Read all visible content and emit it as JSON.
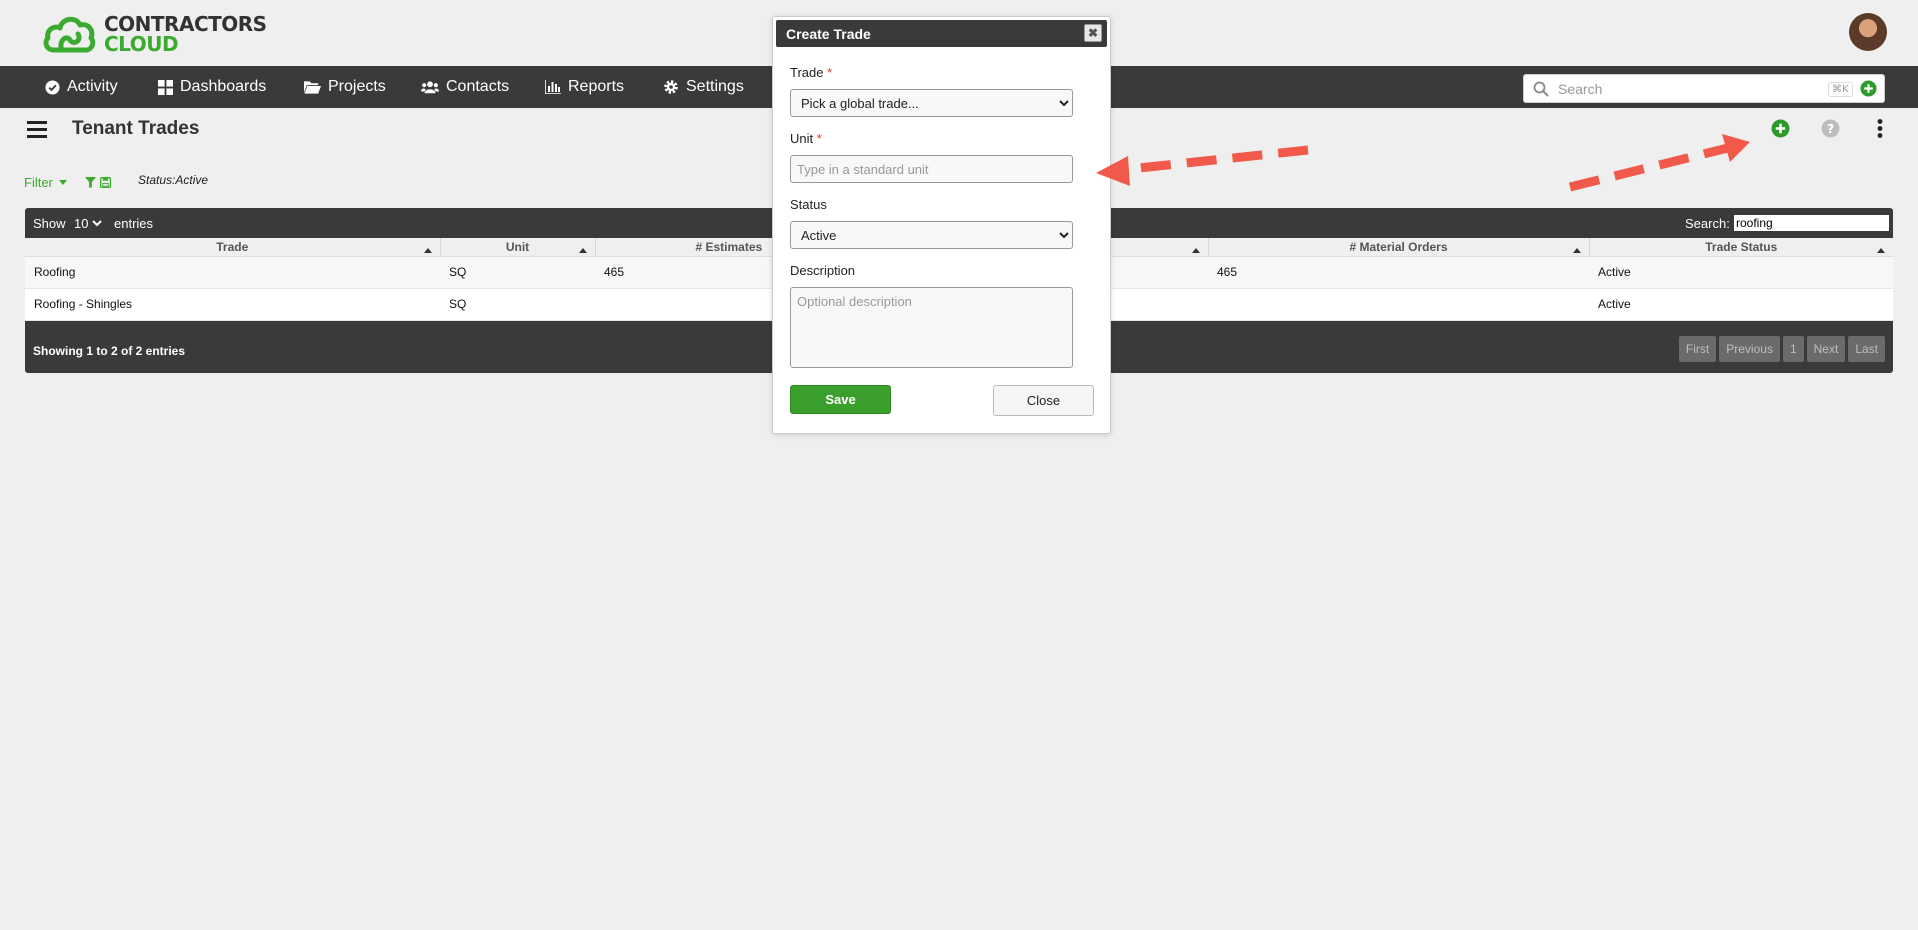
{
  "brand": {
    "line1": "CONTRACTORS",
    "line2": "CLOUD",
    "green": "#3bab2f",
    "dark": "#3a3a3a"
  },
  "nav": {
    "items": [
      {
        "label": "Activity",
        "icon": "check-circle-icon"
      },
      {
        "label": "Dashboards",
        "icon": "grid-icon"
      },
      {
        "label": "Projects",
        "icon": "folder-open-icon"
      },
      {
        "label": "Contacts",
        "icon": "users-icon"
      },
      {
        "label": "Reports",
        "icon": "bar-chart-icon"
      },
      {
        "label": "Settings",
        "icon": "gear-icon"
      }
    ],
    "search_placeholder": "Search",
    "shortcut": "⌘K"
  },
  "page": {
    "title": "Tenant Trades"
  },
  "filter": {
    "label": "Filter",
    "status": "Status:Active"
  },
  "table": {
    "show_label": "Show",
    "page_size": "10",
    "entries_label": "entries",
    "search_label": "Search:",
    "search_value": "roofing",
    "columns": [
      "Trade",
      "Unit",
      "# Estimates",
      "",
      "# Material Orders",
      "Trade Status"
    ],
    "rows": [
      [
        "Roofing",
        "SQ",
        "465",
        "",
        "465",
        "Active"
      ],
      [
        "Roofing - Shingles",
        "SQ",
        "",
        "",
        "",
        "Active"
      ]
    ],
    "footer": "Showing 1 to 2 of 2 entries",
    "pager": [
      "First",
      "Previous",
      "1",
      "Next",
      "Last"
    ]
  },
  "modal": {
    "title": "Create Trade",
    "close_x": "✖",
    "trade_label": "Trade",
    "trade_value": "Pick a global trade...",
    "unit_label": "Unit",
    "unit_placeholder": "Type in a standard unit",
    "status_label": "Status",
    "status_value": "Active",
    "description_label": "Description",
    "description_placeholder": "Optional description",
    "save_label": "Save",
    "close_label": "Close",
    "required_mark": "*"
  },
  "annotation_color": "#f15a4a"
}
